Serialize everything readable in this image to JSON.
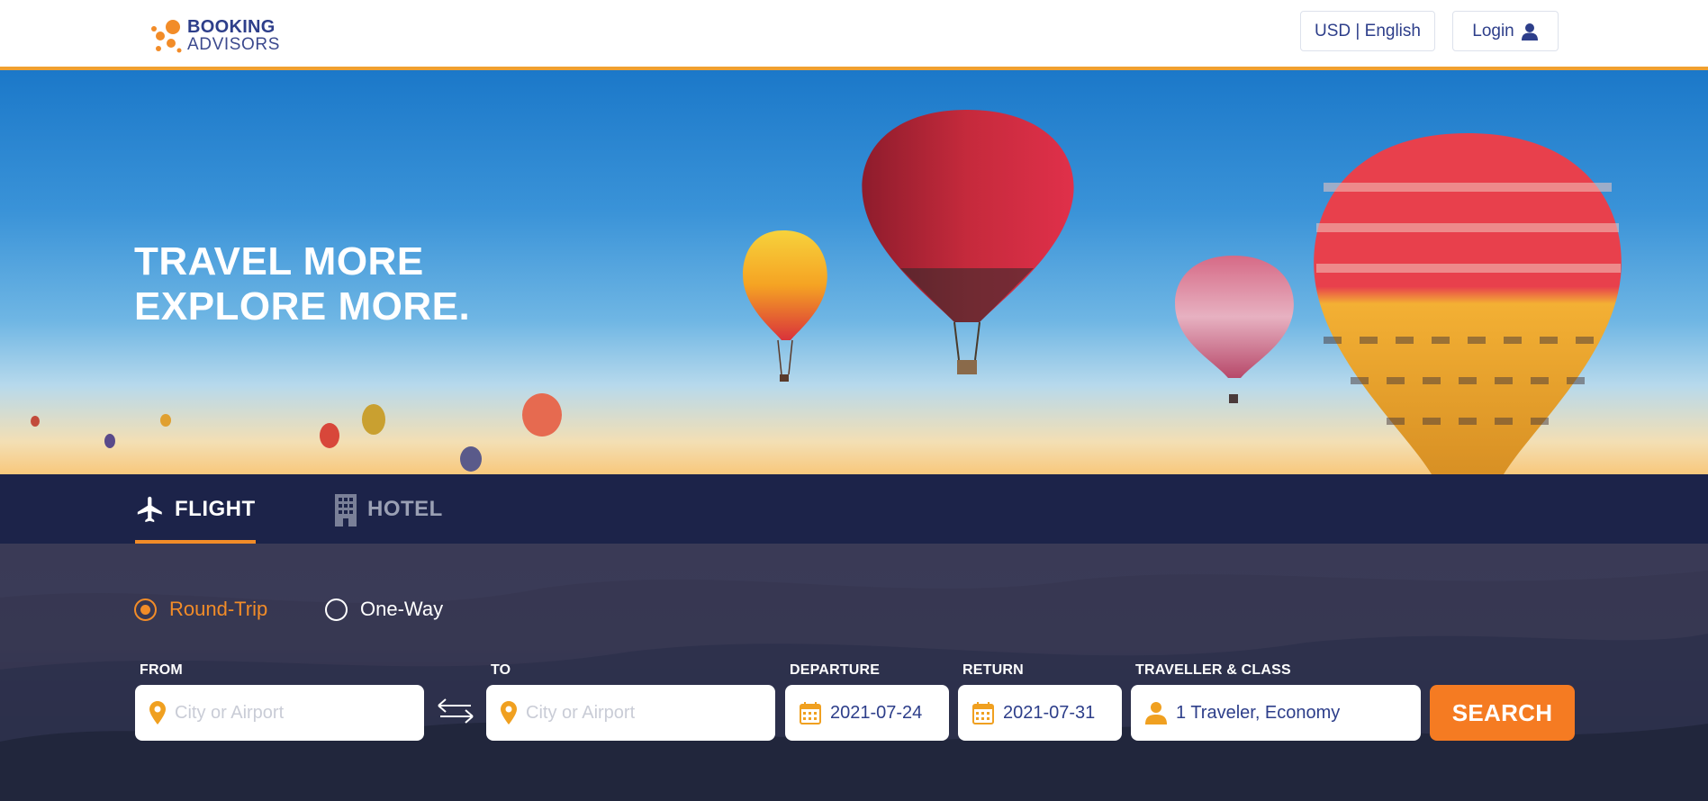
{
  "header": {
    "logo_line1": "BOOKING",
    "logo_line2": "ADVISORS",
    "currency_language": "USD | English",
    "login_label": "Login"
  },
  "hero": {
    "title_line1": "TRAVEL MORE",
    "title_line2": "EXPLORE MORE."
  },
  "tabs": {
    "flight_label": "FLIGHT",
    "hotel_label": "HOTEL",
    "active": "flight"
  },
  "search": {
    "trip_types": [
      "Round-Trip",
      "One-Way"
    ],
    "selected_trip_type": "Round-Trip",
    "from_label": "FROM",
    "from_placeholder": "City or Airport",
    "to_label": "TO",
    "to_placeholder": "City or Airport",
    "departure_label": "DEPARTURE",
    "departure_value": "2021-07-24",
    "return_label": "RETURN",
    "return_value": "2021-07-31",
    "traveller_label": "TRAVELLER & CLASS",
    "traveller_value": "1 Traveler, Economy",
    "search_button": "SEARCH"
  },
  "colors": {
    "brand_navy": "#2d3e8a",
    "accent_orange": "#f28c28",
    "tab_bar": "#1c2349",
    "search_button": "#f57b22"
  }
}
